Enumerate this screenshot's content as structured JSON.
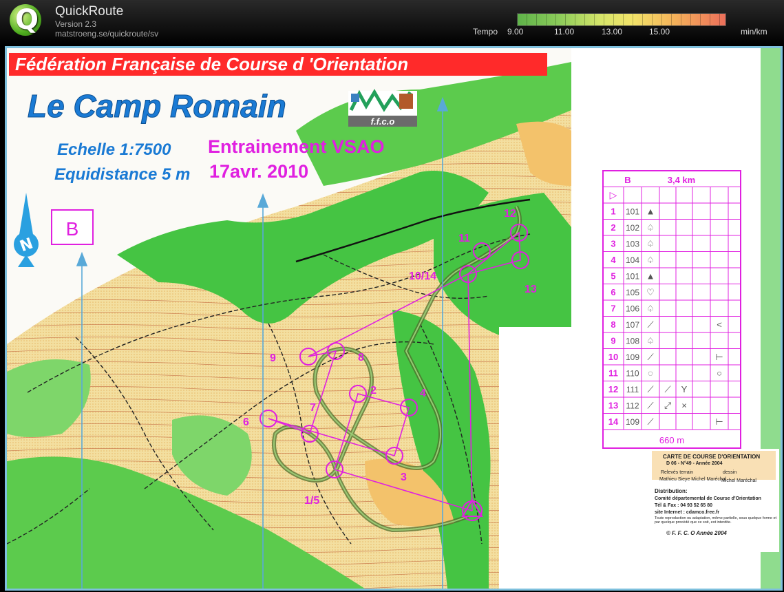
{
  "app": {
    "title": "QuickRoute",
    "version": "Version 2.3",
    "url": "matstroeng.se/quickroute/sv",
    "logo_letter": "Q"
  },
  "tempo": {
    "label": "Tempo",
    "ticks": [
      "9.00",
      "11.00",
      "13.00",
      "15.00"
    ],
    "unit": "min/km"
  },
  "map": {
    "federation_banner": "Fédération Française de Course d 'Orientation",
    "map_name": "Le Camp Romain",
    "scale": "Echelle 1:7500",
    "contour_interval": "Equidistance 5 m",
    "event": "Entrainement VSAO",
    "date": "17avr. 2010",
    "course_box": "B",
    "ffco_logo": "f.f.c.o",
    "north_icon": "north-arrow-icon"
  },
  "controls_on_map": [
    {
      "label": "1/5"
    },
    {
      "label": "2"
    },
    {
      "label": "3"
    },
    {
      "label": "4"
    },
    {
      "label": "6"
    },
    {
      "label": "7"
    },
    {
      "label": "8"
    },
    {
      "label": "9"
    },
    {
      "label": "10/14"
    },
    {
      "label": "11"
    },
    {
      "label": "12"
    },
    {
      "label": "13"
    }
  ],
  "description_sheet": {
    "course": "B",
    "length": "3,4 km",
    "rows": [
      {
        "n": "1",
        "code": "101",
        "symbols": [
          "▲",
          "",
          "",
          "",
          ""
        ]
      },
      {
        "n": "2",
        "code": "102",
        "symbols": [
          "♤",
          "",
          "",
          "",
          ""
        ]
      },
      {
        "n": "3",
        "code": "103",
        "symbols": [
          "♤",
          "",
          "",
          "",
          ""
        ]
      },
      {
        "n": "4",
        "code": "104",
        "symbols": [
          "♤",
          "",
          "",
          "",
          ""
        ]
      },
      {
        "n": "5",
        "code": "101",
        "symbols": [
          "▲",
          "",
          "",
          "",
          ""
        ]
      },
      {
        "n": "6",
        "code": "105",
        "symbols": [
          "♡",
          "",
          "",
          "",
          ""
        ]
      },
      {
        "n": "7",
        "code": "106",
        "symbols": [
          "♤",
          "",
          "",
          "",
          ""
        ]
      },
      {
        "n": "8",
        "code": "107",
        "symbols": [
          "⟋",
          "",
          "",
          "",
          "<"
        ]
      },
      {
        "n": "9",
        "code": "108",
        "symbols": [
          "♤",
          "",
          "",
          "",
          ""
        ]
      },
      {
        "n": "10",
        "code": "109",
        "symbols": [
          "⟋",
          "",
          "",
          "",
          "⊢"
        ]
      },
      {
        "n": "11",
        "code": "110",
        "symbols": [
          "◌",
          "",
          "",
          "",
          "○"
        ]
      },
      {
        "n": "12",
        "code": "111",
        "symbols": [
          "⟋",
          "⟋",
          "Y",
          "",
          ""
        ]
      },
      {
        "n": "13",
        "code": "112",
        "symbols": [
          "⟋",
          "⤢",
          "×",
          "",
          ""
        ]
      },
      {
        "n": "14",
        "code": "109",
        "symbols": [
          "⟋",
          "",
          "",
          "",
          "⊢"
        ]
      }
    ],
    "finish_distance": "660 m"
  },
  "credits": {
    "title": "CARTE DE COURSE D'ORIENTATION",
    "ref": "D 06 - N°49 - Année 2004",
    "survey_label": "Relevés terrain",
    "drawing_label": "dessin",
    "surveyors": "Mathieu Sieye\nMichel Maréchal",
    "drawer": "Michel Maréchal",
    "distribution_label": "Distribution:",
    "distribution": "Comité départemental de Course d'Orientation",
    "phone": "Tél & Fax : 04 93 52 65 80",
    "site": "site Internet : cdamco.free.fr",
    "notice": "Toute reproduction ou adaptation, même partielle, sous quelque forme et par quelque procédé que ce soit, est interdite.",
    "copyright": "© F. F. C. O Année 2004"
  },
  "colors": {
    "forest": "#3fbf3f",
    "light_forest": "#a8e08a",
    "open": "#f3c26b",
    "rough_open": "#f6e6a8",
    "course": "#e020e0",
    "banner": "#ff2222",
    "title_blue": "#1a7ad4",
    "north_blue": "#2aa0e0"
  }
}
